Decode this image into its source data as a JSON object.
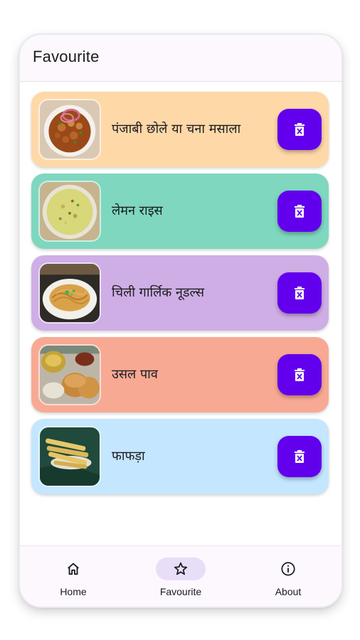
{
  "app_bar": {
    "title": "Favourite"
  },
  "favourites": [
    {
      "title": "पंजाबी छोले या चना मसाला",
      "color": "#ffd8a8",
      "image": "chole-masala-image"
    },
    {
      "title": "लेमन राइस",
      "color": "#7fd7bf",
      "image": "lemon-rice-image"
    },
    {
      "title": "चिली गार्लिक नूडल्स",
      "color": "#cfaee6",
      "image": "chilli-garlic-noodles-image"
    },
    {
      "title": "उसल पाव",
      "color": "#f8a994",
      "image": "usal-pav-image"
    },
    {
      "title": "फाफड़ा",
      "color": "#c4e6ff",
      "image": "fafda-image"
    }
  ],
  "delete_button": {
    "icon": "delete-icon",
    "color": "#6200ee"
  },
  "bottom_nav": {
    "items": [
      {
        "label": "Home",
        "icon": "home-icon",
        "active": false
      },
      {
        "label": "Favourite",
        "icon": "star-icon",
        "active": true
      },
      {
        "label": "About",
        "icon": "info-icon",
        "active": false
      }
    ]
  }
}
